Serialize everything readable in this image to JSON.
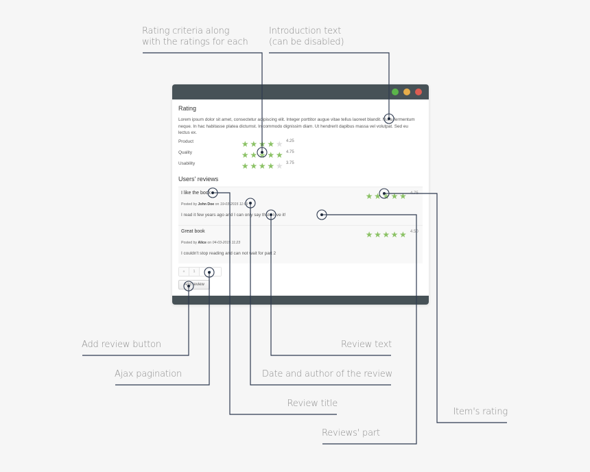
{
  "callouts": {
    "rating_criteria": [
      "Rating criteria along",
      "with the ratings for each"
    ],
    "intro_text": [
      "Introduction text",
      "(can be disabled)"
    ],
    "add_review_button": "Add review button",
    "ajax_pagination": "Ajax pagination",
    "review_text": "Review text",
    "date_author": "Date and author of the review",
    "review_title": "Review title",
    "reviews_part": "Reviews' part",
    "items_rating": "Item's rating"
  },
  "window": {
    "colors": {
      "titlebar": "#475257",
      "green": "#5bb54a",
      "yellow": "#e6ad4a",
      "red": "#dc5d52",
      "star": "#8bc265"
    }
  },
  "rating": {
    "heading": "Rating",
    "intro": "Lorem ipsum dolor sit amet, consectetur adipiscing elit. Integer porttitor augue vitae tellus laoreet blandit. Nulla fermentum neque. In hac habitasse platea dictumst. In commodo dignissim diam. Ut hendrerit dapibus massa vel volutpat. Sed eu lectus ex.",
    "criteria": [
      {
        "label": "Product",
        "value": "4.25",
        "stars_filled": 4
      },
      {
        "label": "Quality",
        "value": "4.75",
        "stars_filled": 5
      },
      {
        "label": "Usability",
        "value": "3.75",
        "stars_filled": 4
      }
    ]
  },
  "reviews": {
    "heading": "Users' reviews",
    "items": [
      {
        "title": "I like the book",
        "posted_by": "Posted by",
        "author": "John Doe",
        "on": "on",
        "date": "19-03-2015 11:09",
        "text": "I read it few years ago and I can only say that I love it!",
        "value": "4.75",
        "stars_filled": 5
      },
      {
        "title": "Great book",
        "posted_by": "Posted by",
        "author": "Alice",
        "on": "on",
        "date": "04-03-2015 11:23",
        "text": "I couldn't stop reading and can not wait for part 2",
        "value": "4.50",
        "stars_filled": 5
      }
    ]
  },
  "pagination": {
    "prev": "«",
    "current": "1",
    "next": "»"
  },
  "add_review_label": "Add review"
}
